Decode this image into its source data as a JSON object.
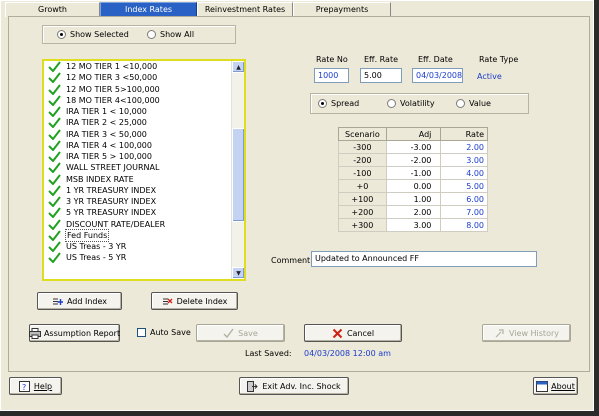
{
  "tabs": [
    {
      "label": "Growth",
      "active": false
    },
    {
      "label": "Index Rates",
      "active": true
    },
    {
      "label": "Reinvestment Rates",
      "active": false
    },
    {
      "label": "Prepayments",
      "active": false
    }
  ],
  "filter": {
    "show_selected_label": "Show Selected",
    "show_all_label": "Show All",
    "selected": "show_selected"
  },
  "index_list": [
    {
      "label": "12 MO TIER 1 <10,000",
      "checked": true
    },
    {
      "label": "12 MO TIER 3 <50,000",
      "checked": true
    },
    {
      "label": "12 MO TIER 5>100,000",
      "checked": true
    },
    {
      "label": "18 MO TIER 4<100,000",
      "checked": true
    },
    {
      "label": "IRA TIER 1 < 10,000",
      "checked": true
    },
    {
      "label": "IRA TIER 2 < 25,000",
      "checked": true
    },
    {
      "label": "IRA TIER 3 < 50,000",
      "checked": true
    },
    {
      "label": "IRA TIER 4 < 100,000",
      "checked": true
    },
    {
      "label": "IRA TIER 5 > 100,000",
      "checked": true
    },
    {
      "label": "WALL STREET JOURNAL",
      "checked": true
    },
    {
      "label": "MSB INDEX RATE",
      "checked": true
    },
    {
      "label": "1 YR TREASURY INDEX",
      "checked": true
    },
    {
      "label": "3 YR TREASURY INDEX",
      "checked": true
    },
    {
      "label": "5 YR TREASURY INDEX",
      "checked": true
    },
    {
      "label": "DISCOUNT RATE/DEALER",
      "checked": true
    },
    {
      "label": "Fed Funds",
      "checked": true,
      "selected": true
    },
    {
      "label": "US Treas - 3 YR",
      "checked": true
    },
    {
      "label": "US Treas - 5 YR",
      "checked": true
    }
  ],
  "list_scroll_fraction": 0.55,
  "buttons": {
    "add_index": "Add Index",
    "delete_index": "Delete Index",
    "assumption_report": "Assumption Report",
    "auto_save": "Auto Save",
    "save": "Save",
    "cancel": "Cancel",
    "view_history": "View History",
    "help": "Help",
    "exit": "Exit Adv. Inc. Shock",
    "about": "About"
  },
  "rate_header": {
    "rate_no_label": "Rate No",
    "eff_rate_label": "Eff. Rate",
    "eff_date_label": "Eff. Date",
    "rate_type_label": "Rate Type",
    "rate_no": "1000",
    "eff_rate": "5.00",
    "eff_date": "04/03/2008",
    "rate_type": "Active"
  },
  "shock_type": {
    "spread": "Spread",
    "volatility": "Volatility",
    "value": "Value",
    "selected": "spread"
  },
  "scenario_table": {
    "headers": [
      "Scenario",
      "Adj",
      "Rate"
    ],
    "rows": [
      [
        "-300",
        "-3.00",
        "2.00"
      ],
      [
        "-200",
        "-2.00",
        "3.00"
      ],
      [
        "-100",
        "-1.00",
        "4.00"
      ],
      [
        "+0",
        "0.00",
        "5.00"
      ],
      [
        "+100",
        "1.00",
        "6.00"
      ],
      [
        "+200",
        "2.00",
        "7.00"
      ],
      [
        "+300",
        "3.00",
        "8.00"
      ]
    ]
  },
  "comment": {
    "label": "Comment:",
    "value": "Updated to Announced FF"
  },
  "last_saved": {
    "label": "Last Saved:",
    "value": "04/03/2008 12:00 am"
  },
  "colors": {
    "active_tab": "#2962c4",
    "link_blue": "#1a3ccc",
    "list_border": "#dede1e",
    "check_green": "#21a121"
  },
  "icons": [
    "add-index-icon",
    "delete-index-icon",
    "printer-icon",
    "checkmark-icon",
    "cancel-x-icon",
    "view-history-icon",
    "help-icon",
    "exit-icon",
    "about-icon"
  ]
}
